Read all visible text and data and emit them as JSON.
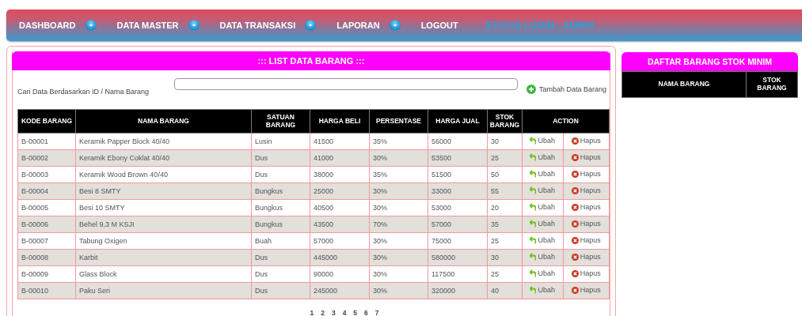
{
  "nav": {
    "items": [
      {
        "label": "DASHBOARD",
        "dropdown": true
      },
      {
        "label": "DATA MASTER",
        "dropdown": true
      },
      {
        "label": "DATA TRANSAKSI",
        "dropdown": true
      },
      {
        "label": "LAPORAN",
        "dropdown": true
      },
      {
        "label": "LOGOUT",
        "dropdown": false
      }
    ],
    "status": "STATUS LOGIN : ADMIN"
  },
  "list_panel": {
    "title": "::: LIST DATA BARANG :::",
    "search_label": "Cari Data Berdasarkan ID / Nama Barang",
    "add_button": "Tambah Data Barang",
    "table": {
      "columns": [
        "KODE BARANG",
        "NAMA BARANG",
        "SATUAN BARANG",
        "HARGA BELI",
        "PERSENTASE",
        "HARGA JUAL",
        "STOK BARANG",
        "ACTION"
      ],
      "rows": [
        {
          "cells": [
            "B-00001",
            "Keramik Papper Block 40/40",
            "Lusin",
            "41500",
            "35%",
            "56000",
            "30"
          ],
          "edit": "Ubah",
          "delete": "Hapus"
        },
        {
          "cells": [
            "B-00002",
            "Keramik Ebony Coklat 40/40",
            "Dus",
            "41000",
            "30%",
            "53500",
            "25"
          ],
          "edit": "Ubah",
          "delete": "Hapus"
        },
        {
          "cells": [
            "B-00003",
            "Keramik Wood Brown 40/40",
            "Dus",
            "38000",
            "35%",
            "51500",
            "50"
          ],
          "edit": "Ubah",
          "delete": "Hapus"
        },
        {
          "cells": [
            "B-00004",
            "Besi 8 SMTY",
            "Bungkus",
            "25000",
            "30%",
            "33000",
            "55"
          ],
          "edit": "Ubah",
          "delete": "Hapus"
        },
        {
          "cells": [
            "B-00005",
            "Besi 10 SMTY",
            "Bungkus",
            "40500",
            "30%",
            "53000",
            "20"
          ],
          "edit": "Ubah",
          "delete": "Hapus"
        },
        {
          "cells": [
            "B-00006",
            "Behel 9,3 M KSJI",
            "Bungkus",
            "43500",
            "70%",
            "57000",
            "35"
          ],
          "edit": "Ubah",
          "delete": "Hapus"
        },
        {
          "cells": [
            "B-00007",
            "Tabung Oxigen",
            "Buah",
            "57000",
            "30%",
            "75000",
            "25"
          ],
          "edit": "Ubah",
          "delete": "Hapus"
        },
        {
          "cells": [
            "B-00008",
            "Karbit",
            "Dus",
            "445000",
            "30%",
            "580000",
            "30"
          ],
          "edit": "Ubah",
          "delete": "Hapus"
        },
        {
          "cells": [
            "B-00009",
            "Glass Block",
            "Dus",
            "90000",
            "30%",
            "117500",
            "25"
          ],
          "edit": "Ubah",
          "delete": "Hapus"
        },
        {
          "cells": [
            "B-00010",
            "Paku Seri",
            "Dus",
            "245000",
            "30%",
            "320000",
            "40"
          ],
          "edit": "Ubah",
          "delete": "Hapus"
        }
      ]
    },
    "pages": [
      "1",
      "2",
      "3",
      "4",
      "5",
      "6",
      "7"
    ]
  },
  "stock_panel": {
    "title": "DAFTAR BARANG STOK MINIM",
    "columns": [
      "NAMA BARANG",
      "STOK BARANG"
    ]
  }
}
